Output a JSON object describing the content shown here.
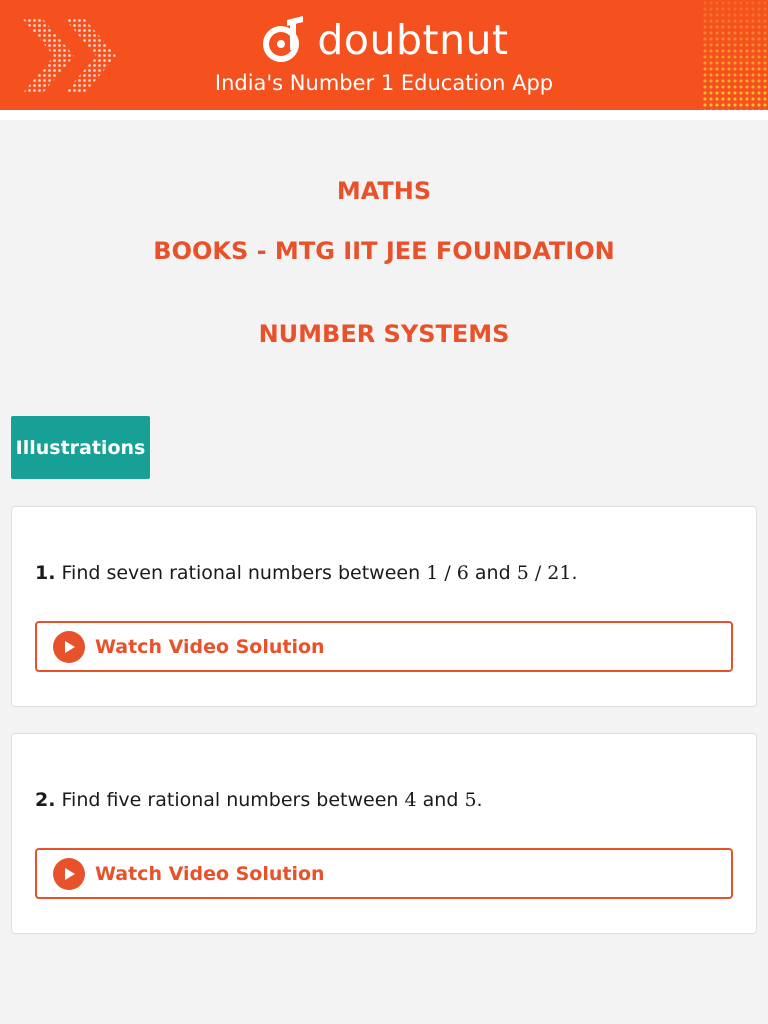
{
  "header": {
    "brand": "doubtnut",
    "tagline": "India's Number 1 Education App",
    "accent": "#f4511e"
  },
  "titles": {
    "subject": "MATHS",
    "book": "BOOKS - MTG IIT JEE FOUNDATION",
    "chapter": "NUMBER SYSTEMS",
    "color": "#e8522a"
  },
  "section_tab": {
    "label": "Illustrations",
    "color": "#16a096"
  },
  "questions": [
    {
      "number": "1.",
      "text_a": "Find seven rational numbers between ",
      "math_1": "1 / 6",
      "text_b": " and ",
      "math_2": "5 / 21",
      "text_c": ".",
      "button_label": "Watch Video Solution",
      "button_icon": "play-icon"
    },
    {
      "number": "2.",
      "text_a": "Find five rational numbers between ",
      "math_1": "4",
      "text_b": " and ",
      "math_2": "5",
      "text_c": ".",
      "button_label": "Watch Video Solution",
      "button_icon": "play-icon"
    }
  ]
}
